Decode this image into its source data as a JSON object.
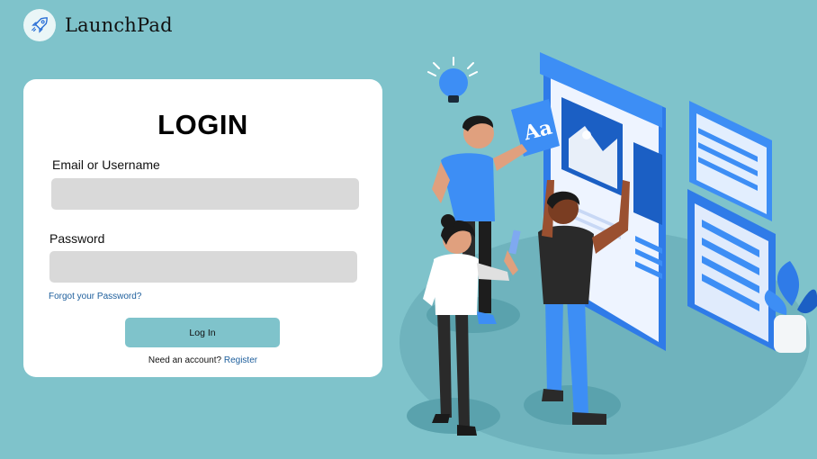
{
  "brand": {
    "name": "LaunchPad",
    "logo_icon": "rocket-icon"
  },
  "login_card": {
    "title": "LOGIN",
    "email_label": "Email or Username",
    "email_value": "",
    "password_label": "Password",
    "password_value": "",
    "forgot_link": "Forgot your Password?",
    "submit_label": "Log In",
    "register_prompt": "Need an account?",
    "register_link": "Register"
  },
  "illustration": {
    "subject": "team-building-website-illustration",
    "card_glyph": "Aa"
  },
  "colors": {
    "background": "#7fc3cb",
    "card": "#ffffff",
    "input_fill": "#d9d9d9",
    "button_fill": "#7fc3cb",
    "link": "#1d5e9c",
    "accent_blue": "#3d8ef5"
  }
}
